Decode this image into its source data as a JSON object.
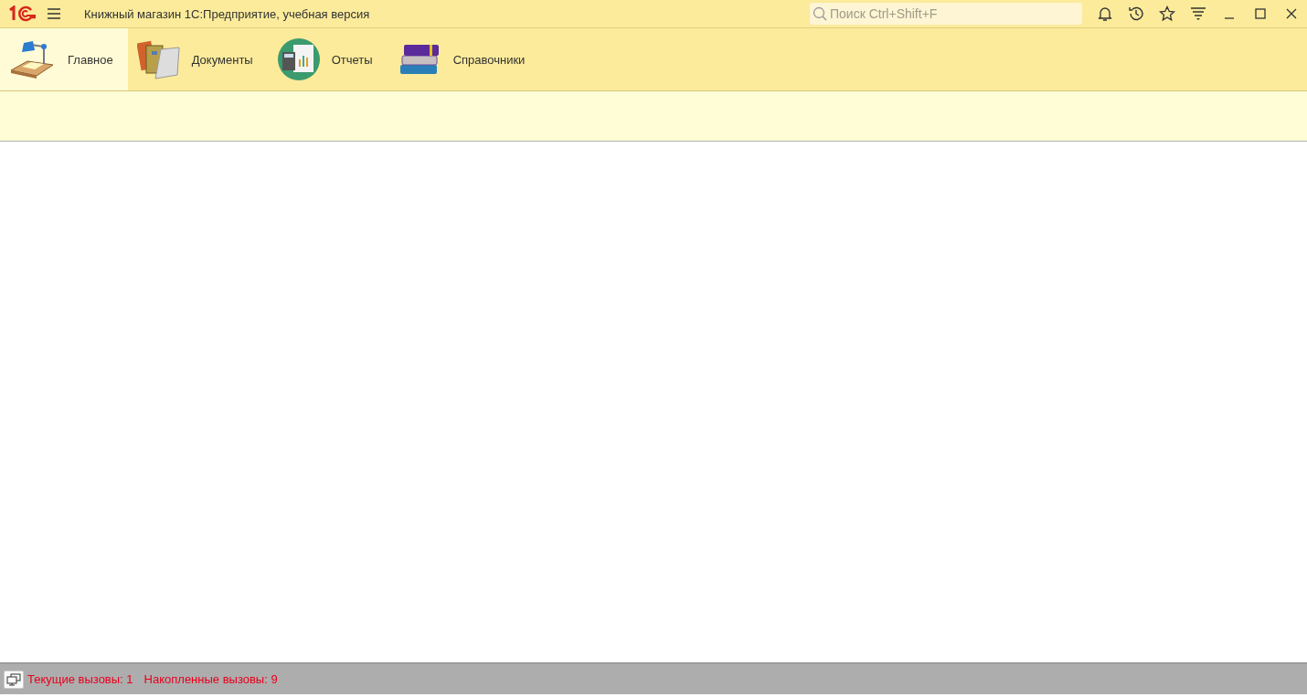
{
  "window": {
    "title": "Книжный магазин 1С:Предприятие, учебная версия"
  },
  "search": {
    "placeholder": "Поиск Ctrl+Shift+F"
  },
  "sections": [
    {
      "label": "Главное",
      "selected": true
    },
    {
      "label": "Документы",
      "selected": false
    },
    {
      "label": "Отчеты",
      "selected": false
    },
    {
      "label": "Справочники",
      "selected": false
    }
  ],
  "status_bar": {
    "items": [
      "Текущие вызовы: 1",
      "Накопленные вызовы: 9"
    ]
  }
}
